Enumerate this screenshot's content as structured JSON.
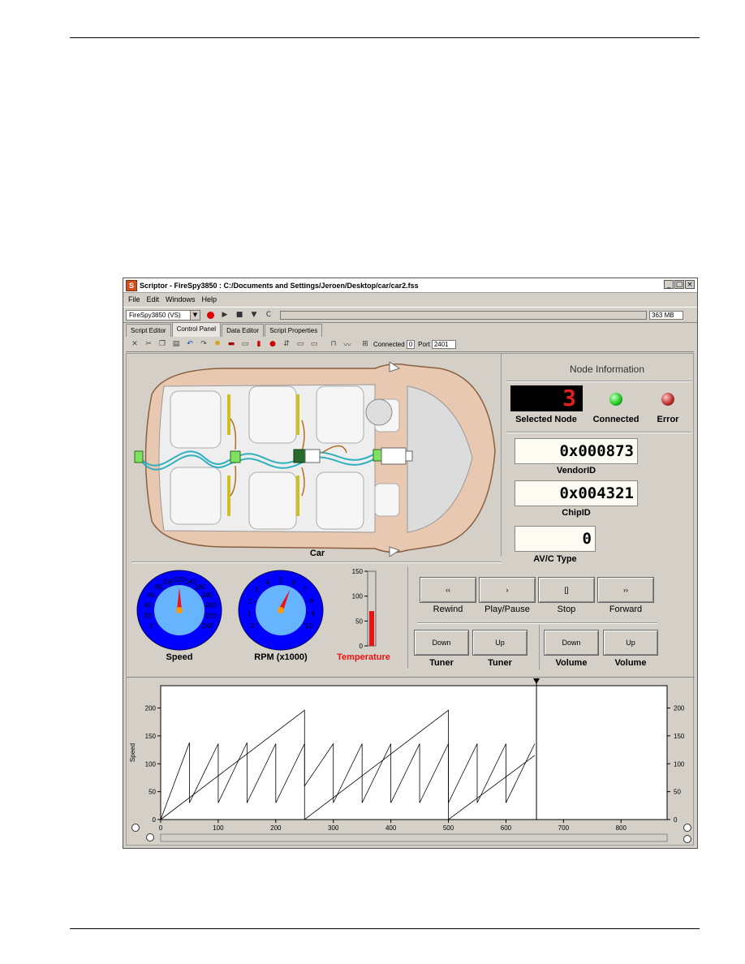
{
  "window": {
    "title": "Scriptor - FireSpy3850 : C:/Documents and Settings/Jeroen/Desktop/car/car2.fss",
    "app_icon": "S",
    "controls": [
      "_",
      "□",
      "×"
    ]
  },
  "menu": [
    "File",
    "Edit",
    "Windows",
    "Help"
  ],
  "toolbar": {
    "device": "FireSpy3850 (VS)",
    "memory": "363 MB",
    "icons": [
      "record-icon",
      "play-icon",
      "stop-icon",
      "pause-icon",
      "clear-icon"
    ]
  },
  "tabs": [
    "Script Editor",
    "Control Panel",
    "Data Editor",
    "Script Properties"
  ],
  "toolbar2": {
    "connected_label": "Connected",
    "connected_value": "0",
    "port_label": "Port",
    "port_value": "2401"
  },
  "car": {
    "label": "Car"
  },
  "node_info": {
    "title": "Node Information",
    "selected_node_value": "3",
    "selected_node_label": "Selected Node",
    "connected_label": "Connected",
    "error_label": "Error",
    "vendor_value": "0x000873",
    "vendor_label": "VendorID",
    "chip_value": "0x004321",
    "chip_label": "ChipID",
    "avc_value": "0",
    "avc_label": "AV/C Type",
    "colors": {
      "connected": "#22cc22",
      "error": "#c03030"
    }
  },
  "gauges": {
    "speed": {
      "label": "Speed",
      "ticks": [
        "0",
        "20",
        "40",
        "60",
        "80",
        "100",
        "120",
        "140",
        "160",
        "180",
        "200",
        "220",
        "240"
      ],
      "max": 240,
      "value": 120
    },
    "rpm": {
      "label": "RPM (x1000)",
      "ticks": [
        "0",
        "1",
        "2",
        "3",
        "4",
        "5",
        "6",
        "7",
        "8",
        "9",
        "10"
      ],
      "max": 10,
      "value": 6
    },
    "temperature": {
      "label": "Temperature",
      "ticks": [
        "0",
        "50",
        "100",
        "150"
      ],
      "max": 150,
      "value": 70,
      "color": "#ee1111"
    }
  },
  "media": {
    "transport": [
      {
        "glyph": "‹‹",
        "label": "Rewind"
      },
      {
        "glyph": "›",
        "label": "Play/Pause"
      },
      {
        "glyph": "[]",
        "label": "Stop"
      },
      {
        "glyph": "››",
        "label": "Forward"
      }
    ],
    "tuning": [
      {
        "glyph": "Down",
        "label": "Tuner"
      },
      {
        "glyph": "Up",
        "label": "Tuner"
      },
      {
        "glyph": "Down",
        "label": "Volume"
      },
      {
        "glyph": "Up",
        "label": "Volume"
      }
    ]
  },
  "chart_data": {
    "type": "line",
    "ylabel": "Speed",
    "xlim": [
      0,
      880
    ],
    "ylim": [
      0,
      240
    ],
    "xticks": [
      0,
      100,
      200,
      300,
      400,
      500,
      600,
      700,
      800
    ],
    "yticks": [
      0,
      50,
      100,
      150,
      200
    ],
    "cursor_x": 653,
    "series": [
      {
        "x": [
          0,
          250,
          250,
          500,
          500,
          650
        ],
        "y": [
          0,
          196,
          0,
          196,
          0,
          115
        ]
      },
      {
        "x": [
          0,
          50,
          50,
          100,
          100,
          150,
          150,
          200,
          200,
          250,
          250,
          300,
          300,
          350,
          350,
          400,
          400,
          450,
          450,
          500,
          500,
          550,
          550,
          600,
          600,
          650
        ],
        "y": [
          0,
          138,
          30,
          136,
          30,
          138,
          30,
          136,
          30,
          136,
          60,
          136,
          30,
          136,
          30,
          136,
          30,
          136,
          30,
          136,
          30,
          136,
          30,
          136,
          30,
          136
        ]
      }
    ]
  }
}
